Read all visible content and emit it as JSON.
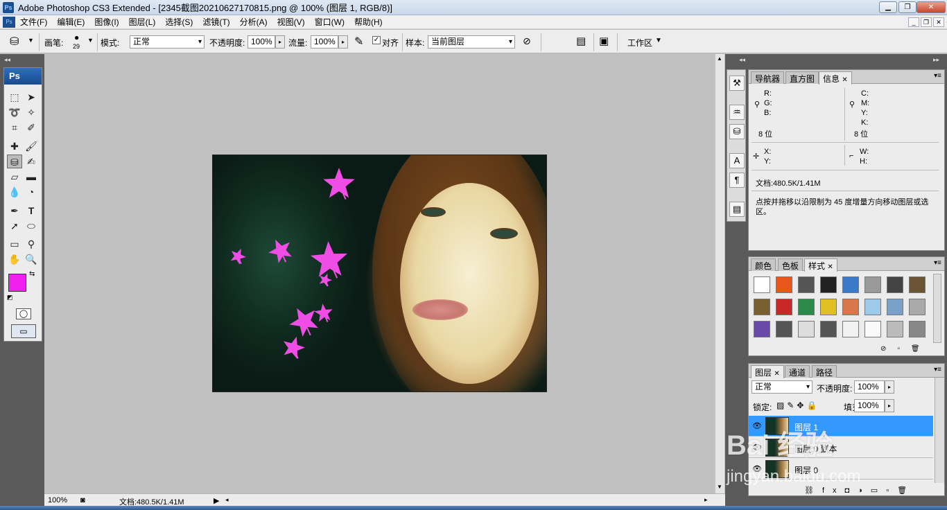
{
  "titlebar": {
    "title": "Adobe Photoshop CS3 Extended - [2345截图20210627170815.png @ 100% (图层 1, RGB/8)]",
    "logo": "Ps"
  },
  "menu": [
    "文件(F)",
    "编辑(E)",
    "图像(I)",
    "图层(L)",
    "选择(S)",
    "滤镜(T)",
    "分析(A)",
    "视图(V)",
    "窗口(W)",
    "帮助(H)"
  ],
  "options": {
    "brush_label": "画笔:",
    "brush_size": "29",
    "mode_label": "模式:",
    "mode_value": "正常",
    "opacity_label": "不透明度:",
    "opacity_value": "100%",
    "flow_label": "流量:",
    "flow_value": "100%",
    "aligned_label": "对齐",
    "sample_label": "样本:",
    "sample_value": "当前图层",
    "workspace_label": "工作区"
  },
  "toolbox": {
    "header": "Ps"
  },
  "status": {
    "zoom": "100%",
    "doc": "文档:480.5K/1.41M"
  },
  "info_panel": {
    "tabs": [
      "导航器",
      "直方图",
      "信息"
    ],
    "rgb": [
      "R:",
      "G:",
      "B:"
    ],
    "cmyk": [
      "C:",
      "M:",
      "Y:",
      "K:"
    ],
    "bits_left": "8 位",
    "bits_right": "8 位",
    "xy": [
      "X:",
      "Y:"
    ],
    "wh": [
      "W:",
      "H:"
    ],
    "doc": "文档:480.5K/1.41M",
    "hint": "点按并拖移以沿限制为 45 度增量方向移动图层或选区。"
  },
  "styles_panel": {
    "tabs": [
      "颜色",
      "色板",
      "样式"
    ]
  },
  "layers_panel": {
    "tabs": [
      "图层",
      "通道",
      "路径"
    ],
    "blend": "正常",
    "opacity_label": "不透明度:",
    "opacity_value": "100%",
    "lock_label": "锁定:",
    "fill_label": "填充:",
    "fill_value": "100%",
    "layers": [
      {
        "name": "图层 1",
        "selected": true
      },
      {
        "name": "图层 0 副本",
        "selected": false
      },
      {
        "name": "图层 0",
        "selected": false
      }
    ]
  },
  "watermark": {
    "brand": "Bai 经验",
    "url": "jingyan.baidu.com"
  },
  "colors": {
    "foreground": "#f021f0",
    "background": "#ffffff",
    "highlight": "#3399ff",
    "leaf": "#ef4de6"
  }
}
